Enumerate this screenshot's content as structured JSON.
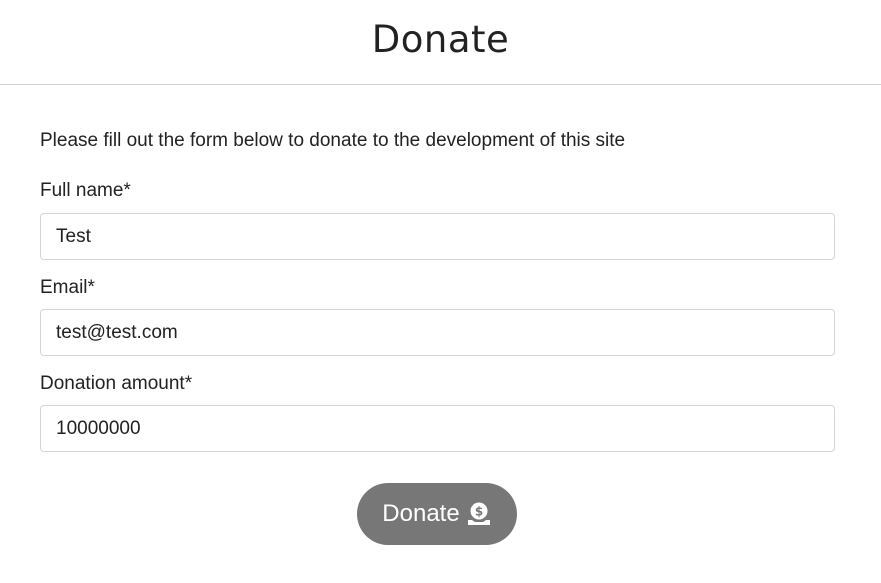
{
  "header": {
    "title": "Donate"
  },
  "form": {
    "intro": "Please fill out the form below to donate to the development of this site",
    "full_name": {
      "label": "Full name*",
      "value": "Test"
    },
    "email": {
      "label": "Email*",
      "value": "test@test.com"
    },
    "amount": {
      "label": "Donation amount*",
      "value": "10000000"
    },
    "submit": {
      "label": "Donate",
      "icon": "hand-holding-dollar-icon",
      "background": "#777777"
    }
  }
}
